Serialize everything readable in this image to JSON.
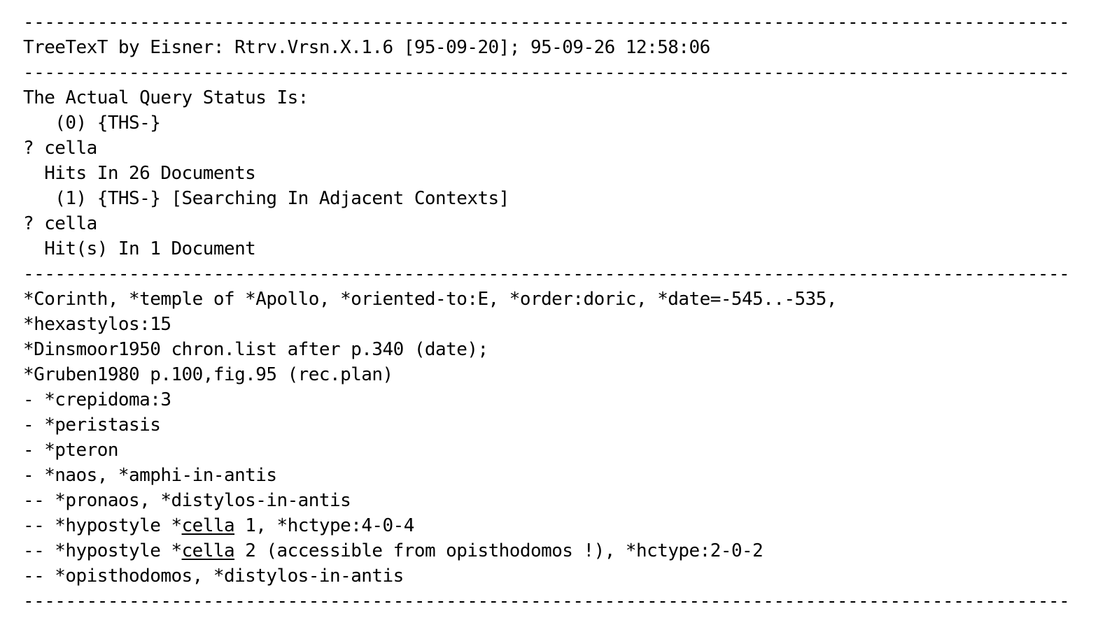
{
  "app": {
    "name": "TreeTexT",
    "author": "Eisner",
    "header_line": "TreeTexT by Eisner: Rtrv.Vrsn.X.1.6 [95-09-20]; 95-09-26 12:58:06",
    "program_label": "TreeTexT by Eisner:",
    "version": "Rtrv.Vrsn.X.1.6",
    "build_date": "[95-09-20]",
    "run_date": "95-09-26",
    "run_time": "12:58:06"
  },
  "separators": {
    "rule_char": "-",
    "rule_text": "----------------------------------------------------------------------------------------",
    "color": "#000000"
  },
  "query_status": {
    "heading": "The Actual Query Status Is:",
    "entries": [
      {
        "line": "   (0) {THS-}",
        "index": "(0)",
        "flag": "{THS-}",
        "note": ""
      },
      {
        "line": "? cella",
        "prompt": "?",
        "term": "cella"
      },
      {
        "line": "  Hits In 26 Documents",
        "hits_text": "Hits In 26 Documents",
        "count": "26"
      },
      {
        "line": "   (1) {THS-} [Searching In Adjacent Contexts]",
        "index": "(1)",
        "flag": "{THS-}",
        "note": "[Searching In Adjacent Contexts]"
      },
      {
        "line": "? cella",
        "prompt": "?",
        "term": "cella"
      },
      {
        "line": "  Hit(s) In 1 Document",
        "hits_text": "Hit(s) In 1 Document",
        "count": "1"
      }
    ]
  },
  "record": {
    "lines": [
      {
        "id": "record-head-1",
        "text": "*Corinth, *temple of *Apollo, *oriented-to:E, *order:doric, *date=-545..-535,"
      },
      {
        "id": "record-head-2",
        "text": "*hexastylos:15"
      },
      {
        "id": "reference-1",
        "text": "*Dinsmoor1950 chron.list after p.340 (date);"
      },
      {
        "id": "reference-2",
        "text": "*Gruben1980 p.100,fig.95 (rec.plan)"
      },
      {
        "id": "tree-crepidoma",
        "text": "- *crepidoma:3"
      },
      {
        "id": "tree-peristasis",
        "text": "- *peristasis"
      },
      {
        "id": "tree-pteron",
        "text": "- *pteron"
      },
      {
        "id": "tree-naos",
        "text": "- *naos, *amphi-in-antis"
      },
      {
        "id": "tree-pronaos",
        "text": "-- *pronaos, *distylos-in-antis"
      }
    ],
    "hit_lines": [
      {
        "id": "tree-hypostyle-cella-1",
        "before": "-- *hypostyle *",
        "hit": "cella",
        "after": " 1, *hctype:4-0-4"
      },
      {
        "id": "tree-hypostyle-cella-2",
        "before": "-- *hypostyle *",
        "hit": "cella",
        "after": " 2 (accessible from opisthodomos !), *hctype:2-0-2"
      }
    ],
    "tail_lines": [
      {
        "id": "tree-opisthodomos",
        "text": "-- *opisthodomos, *distylos-in-antis"
      }
    ]
  },
  "theme": {
    "background": "#ffffff",
    "foreground": "#000000"
  }
}
